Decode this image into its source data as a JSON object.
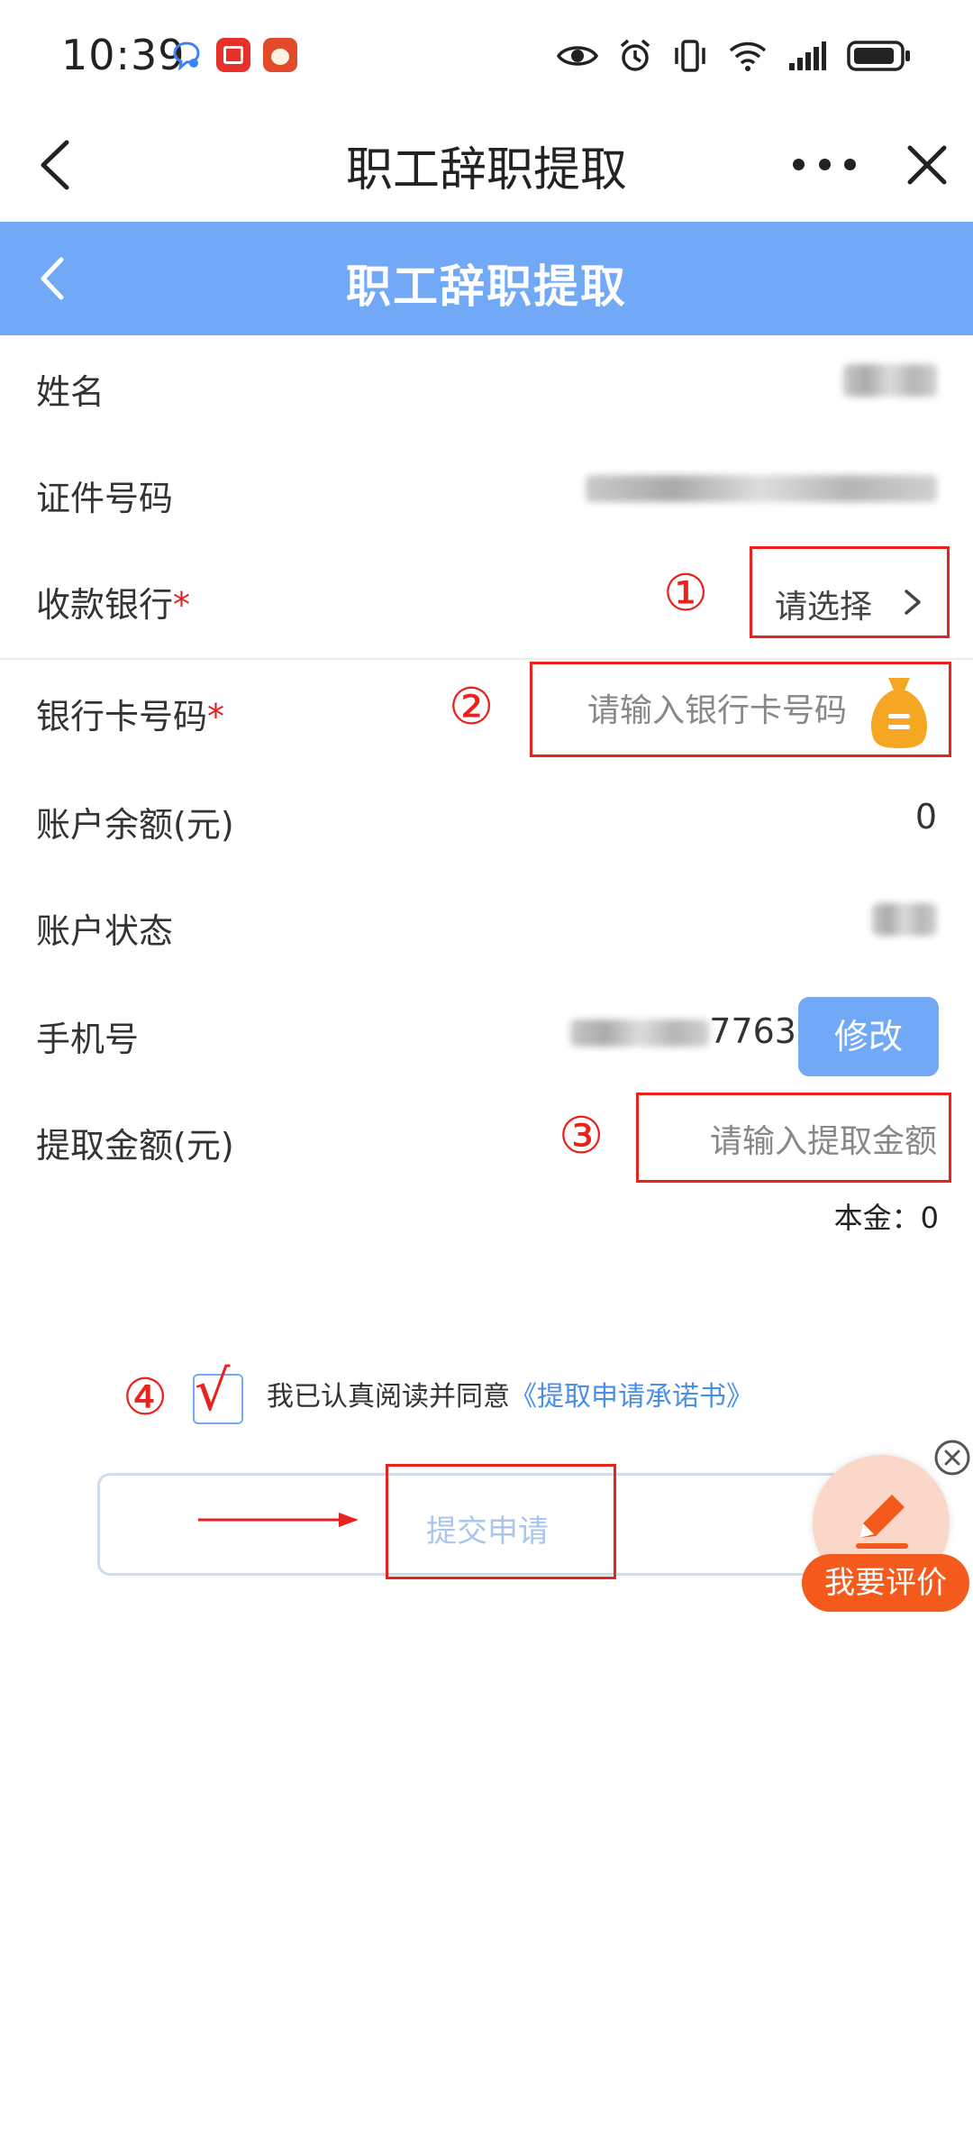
{
  "status_bar": {
    "time": "10:39",
    "icons": [
      "chat-bubble-icon",
      "red-book-app-icon",
      "red-game-app-icon",
      "eye-icon",
      "alarm-icon",
      "vibrate-icon",
      "wifi-icon",
      "signal-icon",
      "battery-icon"
    ]
  },
  "title_bar": {
    "title": "职工辞职提取"
  },
  "header": {
    "title": "职工辞职提取",
    "color": "#72a9f6"
  },
  "form": {
    "name": {
      "label": "姓名"
    },
    "id_number": {
      "label": "证件号码"
    },
    "bank": {
      "label": "收款银行",
      "required_mark": "*",
      "placeholder": "请选择"
    },
    "card_number": {
      "label": "银行卡号码",
      "required_mark": "*",
      "placeholder": "请输入银行卡号码"
    },
    "balance": {
      "label": "账户余额(元)",
      "value": "0"
    },
    "status": {
      "label": "账户状态"
    },
    "phone": {
      "label": "手机号",
      "visible_suffix": "7763",
      "modify_label": "修改"
    },
    "amount": {
      "label": "提取金额(元)",
      "placeholder": "请输入提取金额"
    },
    "principal": {
      "label": "本金：",
      "value": "0"
    }
  },
  "annotations": {
    "markers": [
      "①",
      "②",
      "③",
      "④"
    ],
    "check_mark": "√",
    "highlight_color": "#e8231c"
  },
  "agreement": {
    "text": "我已认真阅读并同意",
    "link": "《提取申请承诺书》"
  },
  "submit": {
    "label": "提交申请"
  },
  "review": {
    "label": "我要评价",
    "color": "#f45a1c"
  }
}
